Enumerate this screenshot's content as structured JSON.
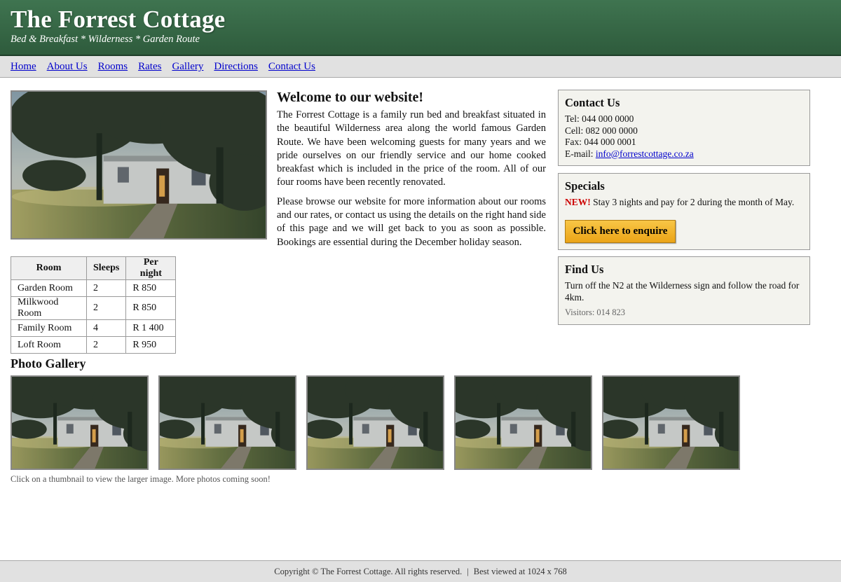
{
  "header": {
    "title": "The Forrest Cottage",
    "tagline": "Bed & Breakfast  *  Wilderness  *  Garden Route"
  },
  "nav": {
    "items": [
      "Home",
      "About Us",
      "Rooms",
      "Rates",
      "Gallery",
      "Directions",
      "Contact Us"
    ]
  },
  "rates": {
    "headers": [
      "Room",
      "Sleeps",
      "Per night"
    ],
    "rows": [
      [
        "Garden Room",
        "2",
        "R 850"
      ],
      [
        "Milkwood Room",
        "2",
        "R 850"
      ],
      [
        "Family Room",
        "4",
        "R 1 400"
      ],
      [
        "Loft Room",
        "2",
        "R 950"
      ]
    ]
  },
  "welcome": {
    "heading": "Welcome to our website!",
    "para1": "The Forrest Cottage is a family run bed and breakfast situated in the beautiful Wilderness area along the world famous Garden Route. We have been welcoming guests for many years and we pride ourselves on our friendly service and our home cooked breakfast which is included in the price of the room. All of our four rooms have been recently renovated.",
    "para2": "Please browse our website for more information about our rooms and our rates, or contact us using the details on the right hand side of this page and we will get back to you as soon as possible. Bookings are essential during the December holiday season."
  },
  "contact": {
    "heading": "Contact Us",
    "tel": "Tel: 044 000 0000",
    "cell": "Cell: 082 000 0000",
    "fax": "Fax: 044 000 0001",
    "email_label": "E-mail: ",
    "email": "info@forrestcottage.co.za"
  },
  "specials": {
    "heading": "Specials",
    "badge": "NEW!",
    "text": " Stay 3 nights and pay for 2 during the month of May.",
    "button": "Click here to enquire"
  },
  "findus": {
    "heading": "Find Us",
    "text": "Turn off the N2 at the Wilderness sign and follow the road for 4km.",
    "visitors": "Visitors: 014 823"
  },
  "gallery": {
    "title": "Photo Gallery",
    "note": "Click on a thumbnail to view the larger image. More photos coming soon!"
  },
  "footer": {
    "copyright": "Copyright © The Forrest Cottage. All rights reserved.",
    "separator": "|",
    "best_viewed": "Best viewed at 1024 x 768"
  },
  "colors": {
    "header_green": "#3f7450",
    "link_blue": "#0000cc",
    "new_red": "#cc0000",
    "button_gold": "#f0b429"
  }
}
